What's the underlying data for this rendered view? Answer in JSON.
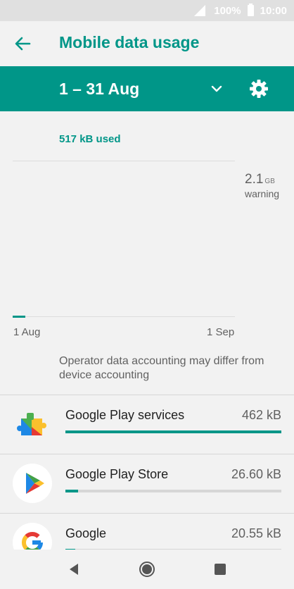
{
  "status_bar": {
    "battery": "100%",
    "time": "10:00"
  },
  "header": {
    "title": "Mobile data usage"
  },
  "cycle": {
    "label": "1 – 31 Aug"
  },
  "summary": {
    "used": "517 kB used"
  },
  "chart": {
    "warning_value": "2.1",
    "warning_unit": "GB",
    "warning_label": "warning",
    "axis_start": "1 Aug",
    "axis_end": "1 Sep"
  },
  "disclaimer": "Operator data accounting may differ from device accounting",
  "apps": [
    {
      "name": "Google Play services",
      "usage": "462 kB",
      "fraction": 1.0,
      "icon": "google-play-services-icon"
    },
    {
      "name": "Google Play Store",
      "usage": "26.60 kB",
      "fraction": 0.06,
      "icon": "google-play-store-icon"
    },
    {
      "name": "Google",
      "usage": "20.55 kB",
      "fraction": 0.045,
      "icon": "google-icon"
    }
  ],
  "colors": {
    "accent": "#009688",
    "background": "#f2f2f2"
  }
}
